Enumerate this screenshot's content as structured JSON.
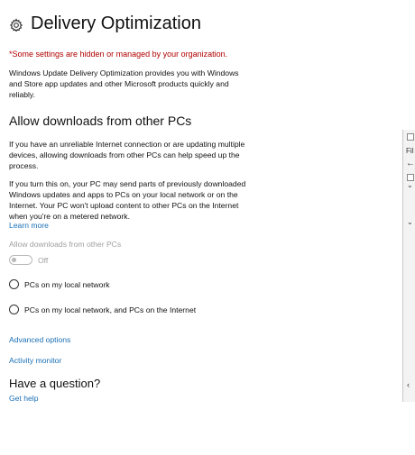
{
  "page": {
    "title": "Delivery Optimization",
    "settings_icon": "gear-icon",
    "warning": "*Some settings are hidden or managed by your organization.",
    "intro": "Windows Update Delivery Optimization provides you with Windows and Store app updates and other Microsoft products quickly and reliably."
  },
  "allow_section": {
    "heading": "Allow downloads from other PCs",
    "para1": "If you have an unreliable Internet connection or are updating multiple devices, allowing downloads from other PCs can help speed up the process.",
    "para2": "If you turn this on, your PC may send parts of previously downloaded Windows updates and apps to PCs on your local network or on the Internet. Your PC won't upload content to other PCs on the Internet when you're on a metered network.",
    "learn_more": "Learn more",
    "toggle_label": "Allow downloads from other PCs",
    "toggle_state": "Off",
    "options": [
      {
        "label": "PCs on my local network"
      },
      {
        "label": "PCs on my local network, and PCs on the Internet"
      }
    ]
  },
  "links": {
    "advanced": "Advanced options",
    "activity": "Activity monitor"
  },
  "question": {
    "heading": "Have a question?",
    "get_help": "Get help"
  },
  "background_window": {
    "label": "Fil",
    "arrow_left": "←",
    "chevron_1": "⌄",
    "chevron_2": "⌄",
    "chevron_3": "‹"
  },
  "colors": {
    "warning": "#b00000",
    "link": "#1a6fb5",
    "disabled": "#a0a0a0"
  }
}
